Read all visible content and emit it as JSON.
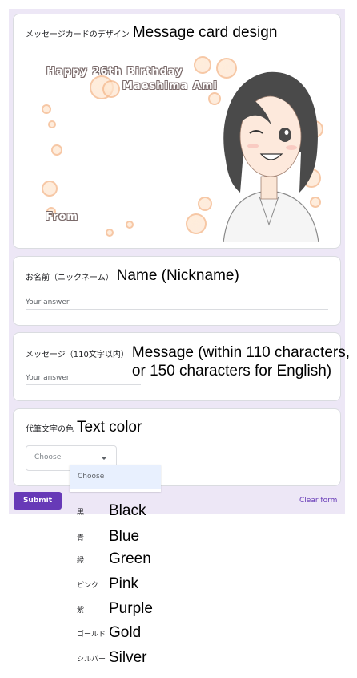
{
  "q1": {
    "ja": "メッセージカードのデザイン",
    "en": "Message card design"
  },
  "banner": {
    "line1": "Happy  26th  Birthday",
    "line2": "Maeshima Ami",
    "from": "From"
  },
  "q2": {
    "ja": "お名前（ニックネーム）",
    "en": "Name (Nickname)",
    "answer_placeholder": "Your answer"
  },
  "q3": {
    "ja": "メッセージ（110文字以内）",
    "en_line1": "Message (within 110 characters,",
    "en_line2": "or 150 characters for English)",
    "answer_placeholder": "Your answer"
  },
  "q4": {
    "ja": "代筆文字の色",
    "en": "Text color",
    "select_placeholder": "Choose"
  },
  "dropdown": {
    "highlighted": "Choose"
  },
  "actions": {
    "submit": "Submit",
    "clear": "Clear form"
  },
  "colors": [
    {
      "ja": "黒",
      "en": "Black"
    },
    {
      "ja": "青",
      "en": "Blue"
    },
    {
      "ja": "緑",
      "en": "Green"
    },
    {
      "ja": "ピンク",
      "en": "Pink"
    },
    {
      "ja": "紫",
      "en": "Purple"
    },
    {
      "ja": "ゴールド",
      "en": "Gold"
    },
    {
      "ja": "シルバー",
      "en": "Silver"
    }
  ],
  "theme": {
    "accent": "#673ab7",
    "form_background": "#ede7f6"
  }
}
